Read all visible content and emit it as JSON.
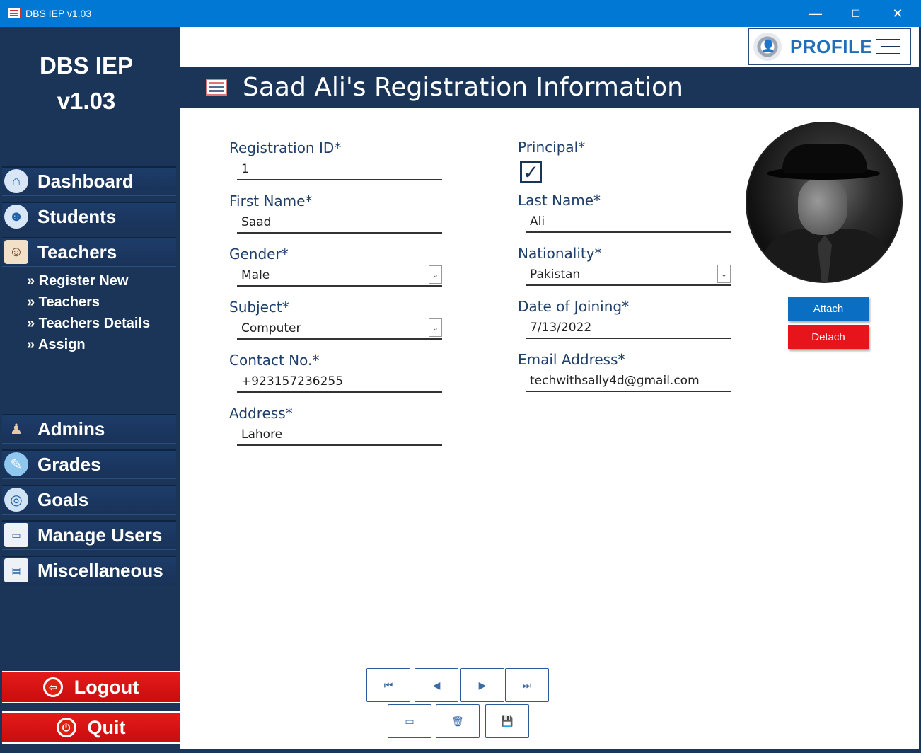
{
  "window": {
    "title": "DBS IEP v1.03",
    "min": "—",
    "max": "☐",
    "close": "✕"
  },
  "sidebar": {
    "brand_line1": "DBS IEP",
    "brand_line2": "v1.03",
    "items": [
      {
        "label": "Dashboard"
      },
      {
        "label": "Students"
      },
      {
        "label": "Teachers"
      },
      {
        "label": "Admins"
      },
      {
        "label": "Grades"
      },
      {
        "label": "Goals"
      },
      {
        "label": "Manage Users"
      },
      {
        "label": "Miscellaneous"
      }
    ],
    "teacher_sub": [
      "» Register New",
      "» Teachers",
      "» Teachers Details",
      "» Assign"
    ],
    "logout": "Logout",
    "quit": "Quit"
  },
  "profile": {
    "label": "PROFILE"
  },
  "header": {
    "title": "Saad Ali's Registration Information"
  },
  "form": {
    "registration_id": {
      "label": "Registration ID*",
      "value": "1"
    },
    "principal": {
      "label": "Principal*",
      "checked": true
    },
    "first_name": {
      "label": "First Name*",
      "value": "Saad"
    },
    "last_name": {
      "label": "Last Name*",
      "value": "Ali"
    },
    "gender": {
      "label": "Gender*",
      "value": "Male"
    },
    "nationality": {
      "label": "Nationality*",
      "value": "Pakistan"
    },
    "subject": {
      "label": "Subject*",
      "value": "Computer"
    },
    "date_of_joining": {
      "label": "Date of Joining*",
      "value": "7/13/2022"
    },
    "contact": {
      "label": "Contact No.*",
      "value": "+923157236255"
    },
    "email": {
      "label": "Email Address*",
      "value": "techwithsally4d@gmail.com"
    },
    "address": {
      "label": "Address*",
      "value": "Lahore"
    }
  },
  "photo_buttons": {
    "attach": "Attach",
    "detach": "Detach"
  },
  "colors": {
    "sidebar": "#1b3558",
    "titlebar": "#0078d4",
    "attach": "#0a6fc2",
    "detach": "#e8141c"
  }
}
